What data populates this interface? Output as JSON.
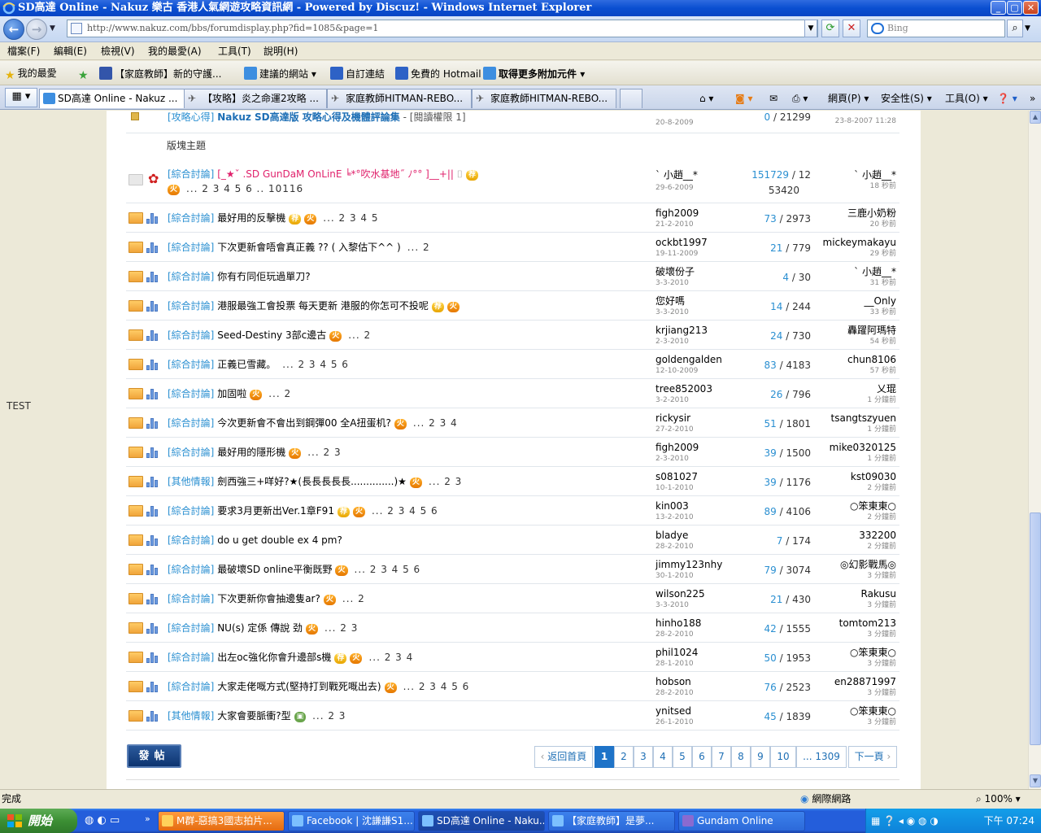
{
  "window": {
    "title": "SD高達 Online - Nakuz 樂古 香港人氣網遊攻略資訊網 - Powered by Discuz! - Windows Internet Explorer"
  },
  "address": {
    "url": "http://www.nakuz.com/bbs/forumdisplay.php?fid=1085&page=1",
    "search_placeholder": "Bing"
  },
  "menu": [
    "檔案(F)",
    "編輯(E)",
    "檢視(V)",
    "我的最愛(A)",
    "工具(T)",
    "說明(H)"
  ],
  "favorites": {
    "label": "我的最愛",
    "items": [
      "【家庭教師】新的守護...",
      "建議的網站",
      "自訂連結",
      "免費的 Hotmail",
      "取得更多附加元件"
    ]
  },
  "tabs": [
    "SD高達 Online - Nakuz ...",
    "【攻略】炎之命運2攻略 ...",
    "家庭教師HITMAN-REBO...",
    "家庭教師HITMAN-REBO..."
  ],
  "toolbar": [
    "網頁(P)",
    "安全性(S)",
    "工具(O)"
  ],
  "page": {
    "side_text": "TEST",
    "top_row": {
      "tag": "[攻略心得]",
      "title": "Nakuz SD高達版 攻略心得及機體評論集",
      "extra": "- [閱讀權限 1]",
      "author_date": "20-8-2009",
      "replies": "0",
      "views": "21299",
      "last_date": "23-8-2007 11:28"
    },
    "section_label": "版塊主題",
    "sticky": {
      "tag": "[綜合討論]",
      "title": "[_★ˇ .SD GunDaM OnLinE ╘*°吹水基地˝ ﾉ°° ]__+||",
      "pages": "... 2 3 4 5 6 .. 10116",
      "author": "ˋ 小趙__*",
      "date": "29-6-2009",
      "replies": "151729",
      "views": "12",
      "views2": "53420",
      "last_author": "ˋ 小趙__*",
      "last_time": "18 秒前"
    },
    "threads": [
      {
        "tag": "[綜合討論]",
        "title": "最好用的反擊機",
        "badges": [
          "rec",
          "hot"
        ],
        "pages": "... 2 3 4 5",
        "author": "figh2009",
        "date": "21-2-2010",
        "replies": "73",
        "views": "2973",
        "last": "三鹿小奶粉",
        "ago": "20 秒前"
      },
      {
        "tag": "[綜合討論]",
        "title": "下次更新會唔會真正義 ?? ( 入黎估下^^ )",
        "badges": [],
        "pages": "... 2",
        "author": "ockbt1997",
        "date": "19-11-2009",
        "replies": "21",
        "views": "779",
        "last": "mickeymakayu",
        "ago": "29 秒前"
      },
      {
        "tag": "[綜合討論]",
        "title": "你有冇同佢玩過單刀?",
        "badges": [],
        "pages": "",
        "author": "破壞份子",
        "date": "3-3-2010",
        "replies": "4",
        "views": "30",
        "last": "ˋ 小趙__*",
        "ago": "31 秒前"
      },
      {
        "tag": "[綜合討論]",
        "title": "港服最強工會投票 每天更新 港服的你怎可不投呢",
        "badges": [
          "rec",
          "hot"
        ],
        "pages": "",
        "author": "您好嗎",
        "date": "3-3-2010",
        "replies": "14",
        "views": "244",
        "last": "__Only",
        "ago": "33 秒前"
      },
      {
        "tag": "[綜合討論]",
        "title": "Seed-Destiny 3部c邊古",
        "badges": [
          "hot"
        ],
        "pages": "... 2",
        "author": "krjiang213",
        "date": "2-3-2010",
        "replies": "24",
        "views": "730",
        "last": "轟躍阿瑪特",
        "ago": "54 秒前"
      },
      {
        "tag": "[綜合討論]",
        "title": "正義已雪藏。",
        "badges": [],
        "pages": "... 2 3 4 5 6",
        "author": "goldengalden",
        "date": "12-10-2009",
        "replies": "83",
        "views": "4183",
        "last": "chun8106",
        "ago": "57 秒前"
      },
      {
        "tag": "[綜合討論]",
        "title": "加固啦",
        "badges": [
          "hot"
        ],
        "pages": "... 2",
        "author": "tree852003",
        "date": "3-2-2010",
        "replies": "26",
        "views": "796",
        "last": "乂琨",
        "ago": "1 分鐘前"
      },
      {
        "tag": "[綜合討論]",
        "title": "今次更新會不會出到鋼彈00 全A扭蛋机?",
        "badges": [
          "hot"
        ],
        "pages": "... 2 3 4",
        "author": "rickysir",
        "date": "27-2-2010",
        "replies": "51",
        "views": "1801",
        "last": "tsangtszyuen",
        "ago": "1 分鐘前"
      },
      {
        "tag": "[綜合討論]",
        "title": "最好用的隱形機",
        "badges": [
          "hot"
        ],
        "pages": "... 2 3",
        "author": "figh2009",
        "date": "2-3-2010",
        "replies": "39",
        "views": "1500",
        "last": "mike0320125",
        "ago": "1 分鐘前"
      },
      {
        "tag": "[其他情報]",
        "title": "劍西強三+咩好?★(長長長長長..............)★",
        "badges": [
          "hot"
        ],
        "pages": "... 2 3",
        "author": "s081027",
        "date": "10-1-2010",
        "replies": "39",
        "views": "1176",
        "last": "kst09030",
        "ago": "2 分鐘前"
      },
      {
        "tag": "[綜合討論]",
        "title": "要求3月更新出Ver.1章F91",
        "badges": [
          "rec",
          "hot"
        ],
        "pages": "... 2 3 4 5 6",
        "author": "kin003",
        "date": "13-2-2010",
        "replies": "89",
        "views": "4106",
        "last": "○笨東東○",
        "ago": "2 分鐘前"
      },
      {
        "tag": "[綜合討論]",
        "title": "do u get double ex 4 pm?",
        "badges": [],
        "pages": "",
        "author": "bladye",
        "date": "28-2-2010",
        "replies": "7",
        "views": "174",
        "last": "332200",
        "ago": "2 分鐘前"
      },
      {
        "tag": "[綜合討論]",
        "title": "最破壞SD online平衡既野",
        "badges": [
          "hot"
        ],
        "pages": "... 2 3 4 5 6",
        "author": "jimmy123nhy",
        "date": "30-1-2010",
        "replies": "79",
        "views": "3074",
        "last": "◎幻影戰馬◎",
        "ago": "3 分鐘前"
      },
      {
        "tag": "[綜合討論]",
        "title": "下次更新你會抽邊隻ar?",
        "badges": [
          "hot"
        ],
        "pages": "... 2",
        "author": "wilson225",
        "date": "3-3-2010",
        "replies": "21",
        "views": "430",
        "last": "Rakusu",
        "ago": "3 分鐘前"
      },
      {
        "tag": "[綜合討論]",
        "title": "NU(s) 定係 傳說 劲",
        "badges": [
          "hot"
        ],
        "pages": "... 2 3",
        "author": "hinho188",
        "date": "28-2-2010",
        "replies": "42",
        "views": "1555",
        "last": "tomtom213",
        "ago": "3 分鐘前"
      },
      {
        "tag": "[綜合討論]",
        "title": "出左oc強化你會升邊部s機",
        "badges": [
          "rec",
          "hot"
        ],
        "pages": "... 2 3 4",
        "author": "phil1024",
        "date": "28-1-2010",
        "replies": "50",
        "views": "1953",
        "last": "○笨東東○",
        "ago": "3 分鐘前"
      },
      {
        "tag": "[綜合討論]",
        "title": "大家走佬嘅方式(堅持打到戰死嘅出去)",
        "badges": [
          "hot"
        ],
        "pages": "... 2 3 4 5 6",
        "author": "hobson",
        "date": "28-2-2010",
        "replies": "76",
        "views": "2523",
        "last": "en28871997",
        "ago": "3 分鐘前"
      },
      {
        "tag": "[其他情報]",
        "title": "大家會要脈衝?型",
        "badges": [
          "img"
        ],
        "pages": "... 2 3",
        "author": "ynitsed",
        "date": "26-1-2010",
        "replies": "45",
        "views": "1839",
        "last": "○笨東東○",
        "ago": "3 分鐘前"
      }
    ],
    "post_button": "發帖",
    "pager": {
      "back": "返回首頁",
      "pages": [
        "1",
        "2",
        "3",
        "4",
        "5",
        "6",
        "7",
        "8",
        "9",
        "10",
        "... 1309"
      ],
      "next": "下一頁"
    }
  },
  "status": {
    "text": "完成",
    "zone": "網際網路",
    "zoom": "100%"
  },
  "taskbar": {
    "start": "開始",
    "tasks": [
      "M群-惡搞3國志拍片...",
      "Facebook | 沈謙謙S1...",
      "SD高達 Online - Naku...",
      "【家庭教師】是夢...",
      "Gundam Online"
    ],
    "clock": "下午 07:24"
  },
  "colors": {
    "title_bar": "#0a4fd1",
    "tag_blue": "#2a8fd1",
    "folder_orange": "#f0a43a",
    "pager_active": "#1e73c8"
  }
}
